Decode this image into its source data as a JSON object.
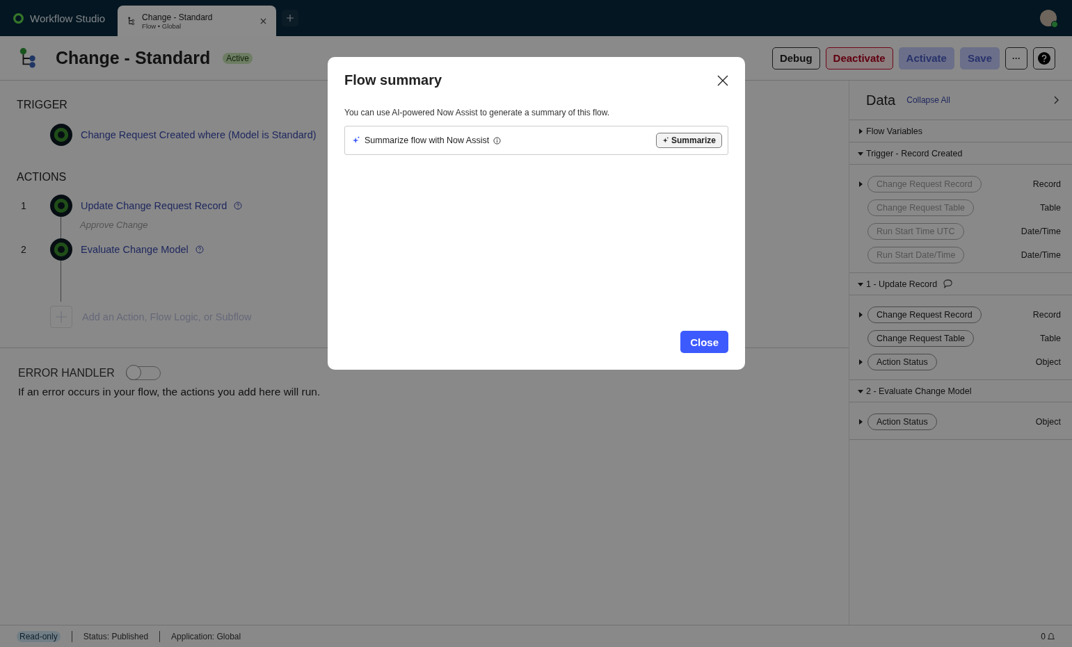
{
  "app": {
    "name": "Workflow Studio"
  },
  "tabs": [
    {
      "title": "Change - Standard",
      "subtitle": "Flow • Global",
      "selected": true
    }
  ],
  "header": {
    "title": "Change - Standard",
    "status": "Active",
    "buttons": [
      {
        "label": "Debug",
        "kind": "outline",
        "disabled": false
      },
      {
        "label": "Deactivate",
        "kind": "danger",
        "disabled": false
      },
      {
        "label": "Activate",
        "kind": "primary",
        "disabled": true
      },
      {
        "label": "Save",
        "kind": "primary",
        "disabled": true
      }
    ],
    "more_label": "···"
  },
  "trigger": {
    "heading": "TRIGGER",
    "label": "Change Request Created where (Model is Standard)"
  },
  "actions": {
    "heading": "ACTIONS",
    "items": [
      {
        "number": "1",
        "label": "Update Change Request Record",
        "annotation": "Approve Change"
      },
      {
        "number": "2",
        "label": "Evaluate Change Model"
      }
    ],
    "add_label": "Add an Action, Flow Logic, or Subflow"
  },
  "error_handler": {
    "heading": "ERROR HANDLER",
    "on": false,
    "description": "If an error occurs in your flow, the actions you add here will run."
  },
  "data_panel": {
    "title": "Data",
    "collapse_label": "Collapse All",
    "sections": [
      {
        "title": "Flow Variables",
        "expanded": false,
        "comment": false
      },
      {
        "title": "Trigger - Record Created",
        "expanded": true,
        "comment": false,
        "variables": [
          {
            "name": "Change Request Record",
            "type": "Record",
            "expandable": true,
            "disabled": true
          },
          {
            "name": "Change Request Table",
            "type": "Table",
            "expandable": false,
            "disabled": true
          },
          {
            "name": "Run Start Time UTC",
            "type": "Date/Time",
            "expandable": false,
            "disabled": true
          },
          {
            "name": "Run Start Date/Time",
            "type": "Date/Time",
            "expandable": false,
            "disabled": true
          }
        ]
      },
      {
        "title": "1 - Update Record",
        "expanded": true,
        "comment": true,
        "variables": [
          {
            "name": "Change Request Record",
            "type": "Record",
            "expandable": true,
            "disabled": false
          },
          {
            "name": "Change Request Table",
            "type": "Table",
            "expandable": false,
            "disabled": false
          },
          {
            "name": "Action Status",
            "type": "Object",
            "expandable": true,
            "disabled": false
          }
        ]
      },
      {
        "title": "2 - Evaluate Change Model",
        "expanded": true,
        "comment": false,
        "variables": [
          {
            "name": "Action Status",
            "type": "Object",
            "expandable": true,
            "disabled": false
          }
        ]
      }
    ]
  },
  "status_bar": {
    "badge": "Read-only",
    "items": [
      "Status: Published",
      "Application: Global"
    ],
    "notifications": "0"
  },
  "dialog": {
    "title": "Flow summary",
    "description": "You can use AI-powered Now Assist to generate a summary of this flow.",
    "prompt": "Summarize flow with Now Assist",
    "action": "Summarize",
    "close_label": "Close"
  }
}
